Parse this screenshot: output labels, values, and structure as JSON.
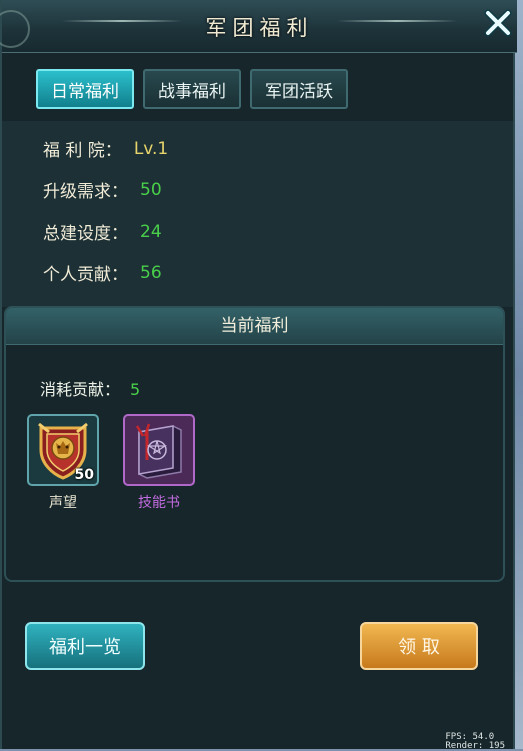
{
  "window": {
    "title": "军团福利"
  },
  "tabs": [
    {
      "label": "日常福利",
      "active": true
    },
    {
      "label": "战事福利",
      "active": false
    },
    {
      "label": "军团活跃",
      "active": false
    }
  ],
  "info": {
    "welfare_hall_label": "福 利 院：",
    "welfare_hall_value": "Lv.1",
    "upgrade_label": "升级需求：",
    "upgrade_value": "50",
    "build_label": "总建设度：",
    "build_value": "24",
    "personal_label": "个人贡献：",
    "personal_value": "56"
  },
  "current": {
    "header": "当前福利",
    "cost_label": "消耗贡献：",
    "cost_value": "5",
    "items": [
      {
        "name": "声望",
        "qty": "50",
        "icon": "prestige-lion-shield-icon",
        "name_color": "#e9e4d2"
      },
      {
        "name": "技能书",
        "qty": "",
        "icon": "skill-book-icon",
        "name_color": "#c36be0"
      }
    ]
  },
  "buttons": {
    "list": "福利一览",
    "claim": "领 取"
  },
  "debug": {
    "fps": "FPS: 54.0",
    "render": "Render: 195"
  },
  "colors": {
    "accent": "#2bbfcc",
    "value_green": "#49d04a",
    "value_yellow": "#e7d46b",
    "claim_orange": "#e8a43c"
  }
}
